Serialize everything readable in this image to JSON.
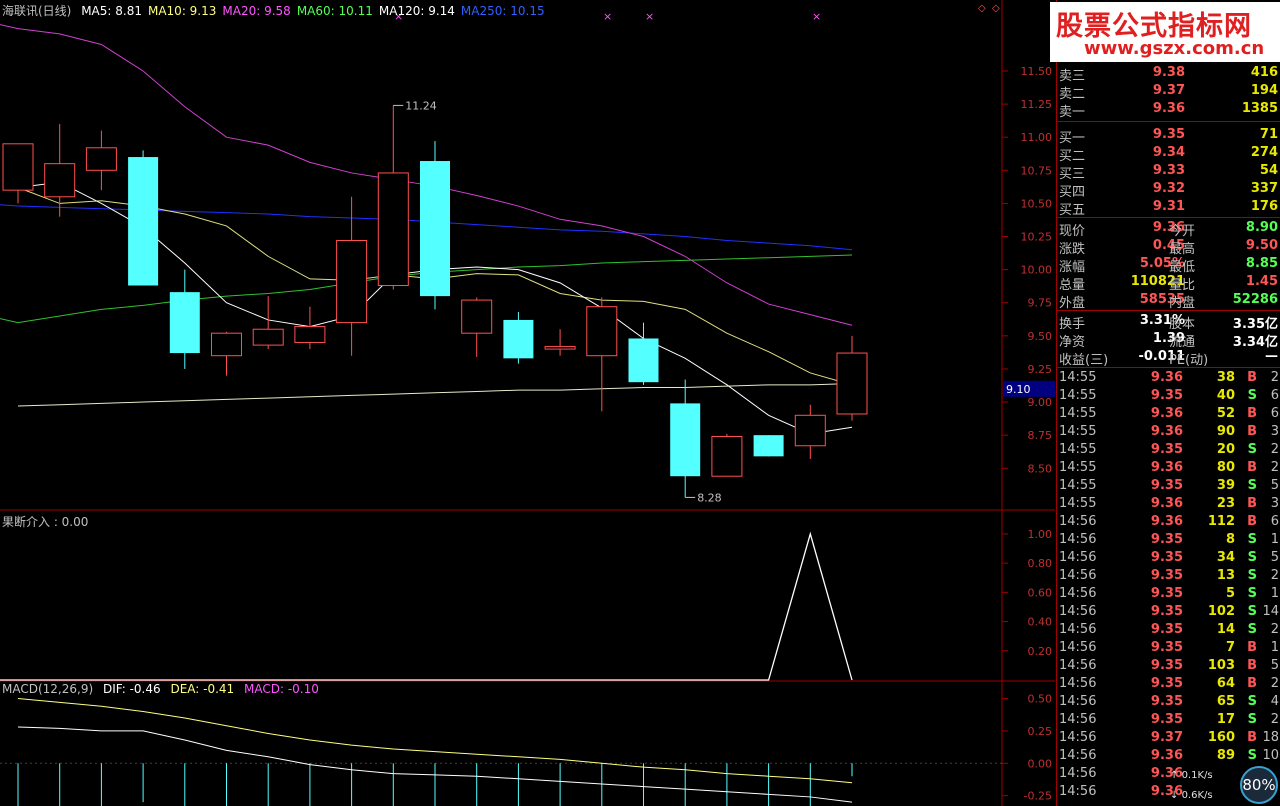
{
  "main_header": {
    "stock_name": "海联讯(日线)",
    "items": [
      {
        "label": "MA5: 8.81",
        "color": "#ffffff"
      },
      {
        "label": "MA10: 9.13",
        "color": "#ffff80"
      },
      {
        "label": "MA20: 9.58",
        "color": "#ff55ff"
      },
      {
        "label": "MA60: 10.11",
        "color": "#55ff55"
      },
      {
        "label": "MA120: 9.14",
        "color": "#ffffff"
      },
      {
        "label": "MA250: 10.15",
        "color": "#3060ff"
      }
    ]
  },
  "price_axis": [
    "11.50",
    "11.25",
    "11.00",
    "10.75",
    "10.50",
    "10.25",
    "10.00",
    "9.75",
    "9.50",
    "9.25",
    "9.00",
    "8.75",
    "8.50"
  ],
  "current_price_tag": "9.10",
  "annotations": {
    "high": "11.24",
    "low": "8.28"
  },
  "indicator": {
    "label": "果断介入 : 0.00",
    "axis": [
      "1.00",
      "0.80",
      "0.60",
      "0.40",
      "0.20"
    ]
  },
  "macd": {
    "label_prefix": "MACD(12,26,9)",
    "dif": "DIF: -0.46",
    "dea": "DEA: -0.41",
    "macd": "MACD: -0.10",
    "axis": [
      "0.50",
      "0.25",
      "0.00",
      "-0.25"
    ]
  },
  "chart_data": {
    "type": "candlestick",
    "price_ylim": [
      8.2,
      11.9
    ],
    "candles": [
      {
        "o": 10.6,
        "h": 10.95,
        "l": 10.5,
        "c": 10.95
      },
      {
        "o": 10.55,
        "h": 11.1,
        "l": 10.4,
        "c": 10.8
      },
      {
        "o": 10.75,
        "h": 11.05,
        "l": 10.6,
        "c": 10.92
      },
      {
        "o": 10.85,
        "h": 10.9,
        "l": 9.88,
        "c": 9.88
      },
      {
        "o": 9.83,
        "h": 10.0,
        "l": 9.25,
        "c": 9.37
      },
      {
        "o": 9.35,
        "h": 9.53,
        "l": 9.2,
        "c": 9.52
      },
      {
        "o": 9.43,
        "h": 9.8,
        "l": 9.4,
        "c": 9.55
      },
      {
        "o": 9.45,
        "h": 9.72,
        "l": 9.4,
        "c": 9.57
      },
      {
        "o": 9.6,
        "h": 10.55,
        "l": 9.35,
        "c": 10.22
      },
      {
        "o": 9.88,
        "h": 11.24,
        "l": 9.85,
        "c": 10.73
      },
      {
        "o": 10.82,
        "h": 10.97,
        "l": 9.7,
        "c": 9.8
      },
      {
        "o": 9.52,
        "h": 9.79,
        "l": 9.34,
        "c": 9.77
      },
      {
        "o": 9.62,
        "h": 9.68,
        "l": 9.29,
        "c": 9.33
      },
      {
        "o": 9.4,
        "h": 9.55,
        "l": 9.35,
        "c": 9.42
      },
      {
        "o": 9.35,
        "h": 9.79,
        "l": 8.93,
        "c": 9.72
      },
      {
        "o": 9.48,
        "h": 9.6,
        "l": 9.13,
        "c": 9.15
      },
      {
        "o": 8.99,
        "h": 9.17,
        "l": 8.28,
        "c": 8.44
      },
      {
        "o": 8.44,
        "h": 8.76,
        "l": 8.44,
        "c": 8.74
      },
      {
        "o": 8.75,
        "h": 8.75,
        "l": 8.59,
        "c": 8.59
      },
      {
        "o": 8.67,
        "h": 8.98,
        "l": 8.57,
        "c": 8.9
      },
      {
        "o": 8.91,
        "h": 9.5,
        "l": 8.86,
        "c": 9.37
      }
    ],
    "ma5": [
      10.62,
      10.66,
      10.5,
      10.32,
      10.05,
      9.75,
      9.62,
      9.57,
      9.65,
      9.96,
      10.0,
      10.02,
      10.0,
      9.9,
      9.71,
      9.48,
      9.33,
      9.13,
      8.9,
      8.76,
      8.81
    ],
    "ma10": [
      10.62,
      10.5,
      10.52,
      10.48,
      10.42,
      10.33,
      10.1,
      9.93,
      9.92,
      9.96,
      9.93,
      9.97,
      9.96,
      9.82,
      9.77,
      9.76,
      9.7,
      9.52,
      9.38,
      9.22,
      9.13
    ],
    "ma20": [
      11.82,
      11.78,
      11.7,
      11.5,
      11.23,
      11.0,
      10.94,
      10.81,
      10.73,
      10.68,
      10.63,
      10.56,
      10.48,
      10.38,
      10.33,
      10.25,
      10.1,
      9.9,
      9.74,
      9.66,
      9.58
    ],
    "ma60": [
      9.6,
      9.65,
      9.7,
      9.73,
      9.77,
      9.8,
      9.82,
      9.85,
      9.9,
      9.95,
      9.98,
      10.0,
      10.02,
      10.03,
      10.05,
      10.06,
      10.07,
      10.08,
      10.09,
      10.1,
      10.11
    ],
    "ma120": [
      8.97,
      8.98,
      8.99,
      9.0,
      9.01,
      9.02,
      9.03,
      9.04,
      9.05,
      9.06,
      9.07,
      9.08,
      9.09,
      9.09,
      9.1,
      9.11,
      9.11,
      9.12,
      9.13,
      9.13,
      9.14
    ],
    "ma250": [
      10.48,
      10.47,
      10.46,
      10.45,
      10.44,
      10.43,
      10.42,
      10.4,
      10.39,
      10.38,
      10.36,
      10.34,
      10.32,
      10.3,
      10.29,
      10.27,
      10.25,
      10.22,
      10.2,
      10.18,
      10.15
    ],
    "signal": [
      0,
      0,
      0,
      0,
      0,
      0,
      0,
      0,
      0,
      0,
      0,
      0,
      0,
      0,
      0,
      0,
      0,
      0,
      0,
      1,
      0
    ],
    "signal_ylim": [
      0,
      1.15
    ],
    "macd_ylim": [
      -0.33,
      0.62
    ],
    "dea": [
      0.5,
      0.47,
      0.44,
      0.4,
      0.35,
      0.29,
      0.23,
      0.18,
      0.14,
      0.11,
      0.09,
      0.07,
      0.05,
      0.03,
      0.0,
      -0.03,
      -0.05,
      -0.08,
      -0.1,
      -0.12,
      -0.15
    ],
    "dif": [
      0.28,
      0.27,
      0.25,
      0.25,
      0.18,
      0.1,
      0.05,
      -0.01,
      -0.05,
      -0.08,
      -0.09,
      -0.1,
      -0.12,
      -0.14,
      -0.16,
      -0.18,
      -0.2,
      -0.22,
      -0.24,
      -0.26,
      -0.3
    ],
    "macd_bars": [
      -0.6,
      -0.6,
      -0.6,
      -0.3,
      -0.35,
      -0.38,
      -0.38,
      -0.38,
      -0.37,
      -0.37,
      -0.38,
      -0.38,
      -0.37,
      -0.38,
      -0.38,
      -0.38,
      -0.38,
      -0.38,
      -0.38,
      -0.38,
      -0.1
    ]
  },
  "quotes": {
    "sell": [
      {
        "label": "卖三",
        "price": "9.38",
        "vol": "416"
      },
      {
        "label": "卖二",
        "price": "9.37",
        "vol": "194"
      },
      {
        "label": "卖一",
        "price": "9.36",
        "vol": "1385"
      }
    ],
    "buy": [
      {
        "label": "买一",
        "price": "9.35",
        "vol": "71"
      },
      {
        "label": "买二",
        "price": "9.34",
        "vol": "274"
      },
      {
        "label": "买三",
        "price": "9.33",
        "vol": "54"
      },
      {
        "label": "买四",
        "price": "9.32",
        "vol": "337"
      },
      {
        "label": "买五",
        "price": "9.31",
        "vol": "176"
      }
    ]
  },
  "stats": [
    {
      "l1": "现价",
      "v1": "9.36",
      "c1": "red",
      "l2": "今开",
      "v2": "8.90",
      "c2": "green"
    },
    {
      "l1": "涨跌",
      "v1": "0.45",
      "c1": "red",
      "l2": "最高",
      "v2": "9.50",
      "c2": "red"
    },
    {
      "l1": "涨幅",
      "v1": "5.05%",
      "c1": "red",
      "l2": "最低",
      "v2": "8.85",
      "c2": "green"
    },
    {
      "l1": "总量",
      "v1": "110821",
      "c1": "yellow",
      "l2": "量比",
      "v2": "1.45",
      "c2": "red"
    },
    {
      "l1": "外盘",
      "v1": "58535",
      "c1": "red",
      "l2": "内盘",
      "v2": "52286",
      "c2": "green"
    }
  ],
  "stats2": [
    {
      "l1": "换手",
      "v1": "3.31%",
      "l2": "股本",
      "v2": "3.35亿"
    },
    {
      "l1": "净资",
      "v1": "1.39",
      "l2": "流通",
      "v2": "3.34亿"
    },
    {
      "l1": "收益(三)",
      "v1": "-0.011",
      "l2": "PE(动)",
      "v2": "—"
    }
  ],
  "ticks": [
    {
      "t": "14:55",
      "p": "9.36",
      "v": "38",
      "bs": "B",
      "n": "2"
    },
    {
      "t": "14:55",
      "p": "9.35",
      "v": "40",
      "bs": "S",
      "n": "6"
    },
    {
      "t": "14:55",
      "p": "9.36",
      "v": "52",
      "bs": "B",
      "n": "6"
    },
    {
      "t": "14:55",
      "p": "9.36",
      "v": "90",
      "bs": "B",
      "n": "3"
    },
    {
      "t": "14:55",
      "p": "9.35",
      "v": "20",
      "bs": "S",
      "n": "2"
    },
    {
      "t": "14:55",
      "p": "9.36",
      "v": "80",
      "bs": "B",
      "n": "2"
    },
    {
      "t": "14:55",
      "p": "9.35",
      "v": "39",
      "bs": "S",
      "n": "5"
    },
    {
      "t": "14:55",
      "p": "9.36",
      "v": "23",
      "bs": "B",
      "n": "3"
    },
    {
      "t": "14:56",
      "p": "9.36",
      "v": "112",
      "bs": "B",
      "n": "6"
    },
    {
      "t": "14:56",
      "p": "9.35",
      "v": "8",
      "bs": "S",
      "n": "1"
    },
    {
      "t": "14:56",
      "p": "9.35",
      "v": "34",
      "bs": "S",
      "n": "5"
    },
    {
      "t": "14:56",
      "p": "9.35",
      "v": "13",
      "bs": "S",
      "n": "2"
    },
    {
      "t": "14:56",
      "p": "9.35",
      "v": "5",
      "bs": "S",
      "n": "1"
    },
    {
      "t": "14:56",
      "p": "9.35",
      "v": "102",
      "bs": "S",
      "n": "14"
    },
    {
      "t": "14:56",
      "p": "9.35",
      "v": "14",
      "bs": "S",
      "n": "2"
    },
    {
      "t": "14:56",
      "p": "9.35",
      "v": "7",
      "bs": "B",
      "n": "1"
    },
    {
      "t": "14:56",
      "p": "9.35",
      "v": "103",
      "bs": "B",
      "n": "5"
    },
    {
      "t": "14:56",
      "p": "9.35",
      "v": "64",
      "bs": "B",
      "n": "2"
    },
    {
      "t": "14:56",
      "p": "9.35",
      "v": "65",
      "bs": "S",
      "n": "4"
    },
    {
      "t": "14:56",
      "p": "9.35",
      "v": "17",
      "bs": "S",
      "n": "2"
    },
    {
      "t": "14:56",
      "p": "9.37",
      "v": "160",
      "bs": "B",
      "n": "18"
    },
    {
      "t": "14:56",
      "p": "9.36",
      "v": "89",
      "bs": "S",
      "n": "10"
    },
    {
      "t": "14:56",
      "p": "9.36",
      "v": "",
      "bs": "",
      "n": ""
    },
    {
      "t": "14:56",
      "p": "9.36",
      "v": "",
      "bs": "",
      "n": ""
    }
  ],
  "watermark": {
    "title": "股票公式指标网",
    "url": "www.gszx.com.cn"
  },
  "network": {
    "up": "0.1K/s",
    "down": "0.6K/s",
    "gauge": "80%"
  }
}
